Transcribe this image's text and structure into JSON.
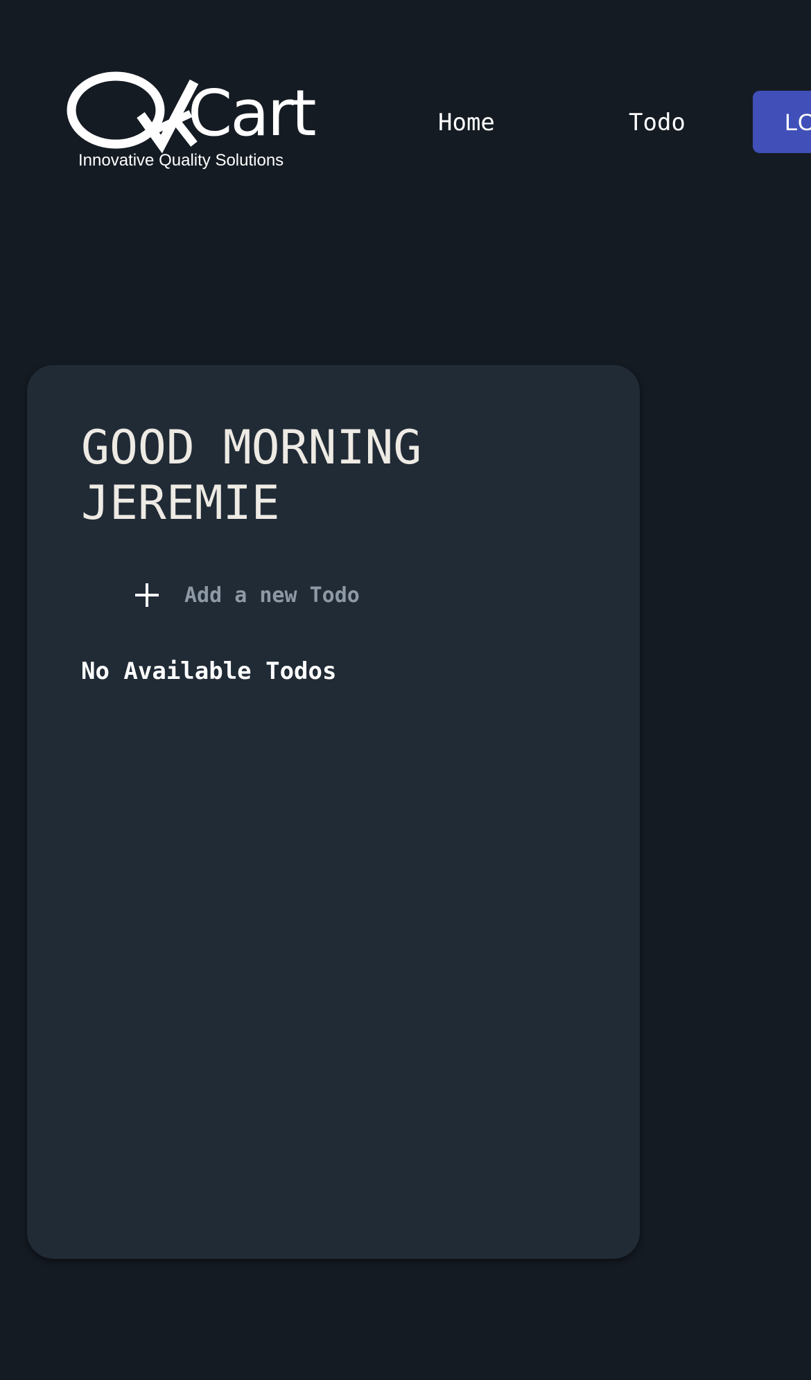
{
  "header": {
    "logo": {
      "wordmark": "QACart",
      "tagline": "Innovative Quality Solutions"
    },
    "nav": {
      "home_label": "Home",
      "todo_label": "Todo"
    },
    "logout_label": "LOGOUT"
  },
  "card": {
    "greeting_line1": "GOOD MORNING",
    "greeting_line2": "JEREMIE",
    "add_todo": {
      "placeholder": "Add a new Todo",
      "value": ""
    },
    "empty_message": "No Available Todos"
  },
  "colors": {
    "page_background": "#151b23",
    "card_background": "#212b36",
    "accent_button": "#4050b8",
    "heading_text": "#eeeae4",
    "placeholder_text": "#8e99a6"
  },
  "icons": {
    "add": "plus-icon"
  }
}
